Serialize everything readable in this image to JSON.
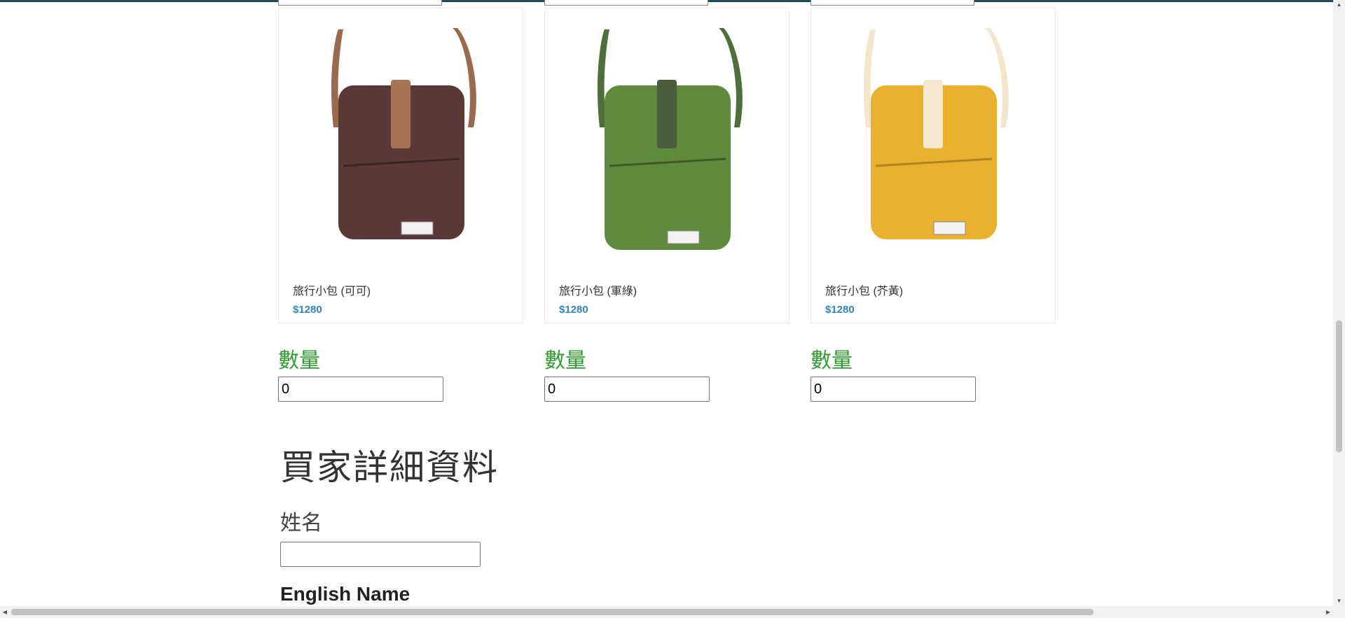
{
  "products": [
    {
      "title": "旅行小包 (可可)",
      "price": "$1280",
      "color": "#5a3836",
      "strap": "#9b6a4e",
      "buckle": "#a67355",
      "label": "數量",
      "qty": "0"
    },
    {
      "title": "旅行小包 (軍綠)",
      "price": "$1280",
      "color": "#5f8a3e",
      "strap": "#4e6e3a",
      "buckle": "#4a5e3e",
      "label": "數量",
      "qty": "0"
    },
    {
      "title": "旅行小包 (芥黃)",
      "price": "$1280",
      "color": "#eab12e",
      "strap": "#f2e6cc",
      "buckle": "#f4e8cf",
      "label": "數量",
      "qty": "0"
    }
  ],
  "buyer": {
    "section_title": "買家詳細資料",
    "name_label": "姓名",
    "name_value": "",
    "english_name_label": "English Name"
  },
  "theme": {
    "accent": "#2e86c9",
    "qty_label_color": "#2e9e2e"
  }
}
